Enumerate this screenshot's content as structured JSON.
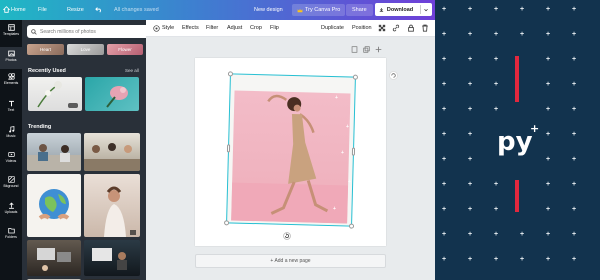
{
  "topbar": {
    "home": "Home",
    "file": "File",
    "resize": "Resize",
    "saved_status": "All changes saved",
    "new_design": "New design",
    "try_pro": "Try Canva Pro",
    "share": "Share",
    "download": "Download"
  },
  "sidebar": {
    "items": [
      {
        "label": "Templates",
        "icon": "templates-icon"
      },
      {
        "label": "Photos",
        "icon": "photos-icon"
      },
      {
        "label": "Elements",
        "icon": "elements-icon"
      },
      {
        "label": "Text",
        "icon": "text-icon"
      },
      {
        "label": "Music",
        "icon": "music-icon"
      },
      {
        "label": "Videos",
        "icon": "videos-icon"
      },
      {
        "label": "Bkground",
        "icon": "background-icon"
      },
      {
        "label": "Uploads",
        "icon": "uploads-icon"
      },
      {
        "label": "Folders",
        "icon": "folders-icon"
      }
    ]
  },
  "panel": {
    "search_placeholder": "Search millions of photos",
    "pills": [
      "Heart",
      "Love",
      "Flower"
    ],
    "recently_used": "Recently Used",
    "see_all": "See all",
    "trending": "Trending"
  },
  "toolbar": {
    "style": "Style",
    "effects": "Effects",
    "filter": "Filter",
    "adjust": "Adjust",
    "crop": "Crop",
    "flip": "Flip",
    "duplicate": "Duplicate",
    "position": "Position"
  },
  "canvas": {
    "add_page": "+ Add a new page"
  },
  "brand": {
    "logo": "py",
    "logo_sup": "+"
  },
  "colors": {
    "accent_red": "#e2283e",
    "brand_bg": "#12334e",
    "selection": "#27c0d3",
    "photo_pink": "#f0b8c4"
  }
}
